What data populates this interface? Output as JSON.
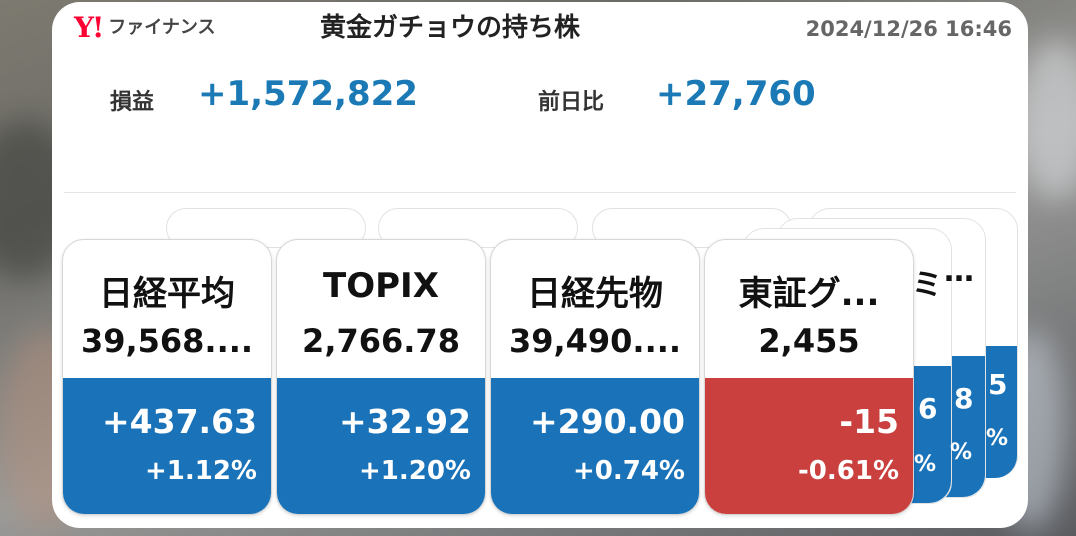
{
  "header": {
    "logo_mark": "Y!",
    "logo_text": "ファイナンス",
    "title": "黄金ガチョウの持ち株",
    "timestamp": "2024/12/26 16:46"
  },
  "summary": {
    "pnl_label": "損益",
    "pnl_value": "+1,572,822",
    "day_change_label": "前日比",
    "day_change_value": "+27,760"
  },
  "cards": [
    {
      "name": "日経平均",
      "price": "39,568....",
      "change": "+437.63",
      "percent": "+1.12%",
      "color": "#1a73b8"
    },
    {
      "name": "TOPIX",
      "price": "2,766.78",
      "change": "+32.92",
      "percent": "+1.20%",
      "color": "#1a73b8"
    },
    {
      "name": "日経先物",
      "price": "39,490....",
      "change": "+290.00",
      "percent": "+0.74%",
      "color": "#1a73b8"
    },
    {
      "name": "東証グ...",
      "price": "2,455",
      "change": "-15",
      "percent": "-0.61%",
      "color": "#c9403f"
    }
  ],
  "peek": {
    "name_fragment": "ミ",
    "ellipsis": "…",
    "digits": [
      "6",
      "8",
      "5"
    ],
    "percent_fragments": [
      "%",
      "%",
      "%"
    ]
  },
  "colors": {
    "up": "#1a73b8",
    "down": "#c9403f",
    "accent": "#1b7ab5",
    "logo": "#ff0033"
  }
}
